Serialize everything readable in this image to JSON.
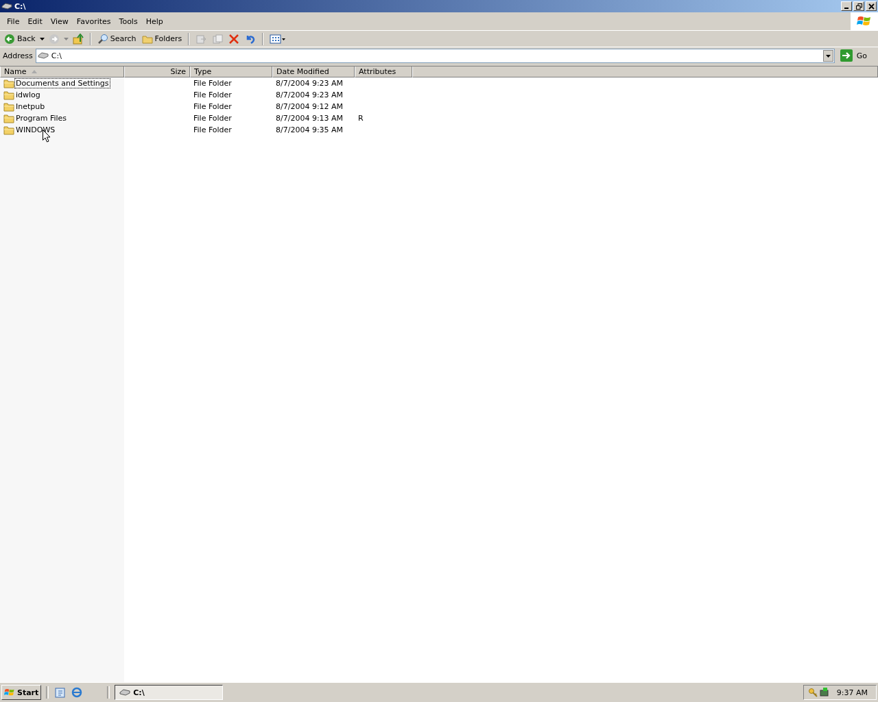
{
  "window": {
    "title": "C:\\"
  },
  "menu": [
    "File",
    "Edit",
    "View",
    "Favorites",
    "Tools",
    "Help"
  ],
  "toolbar": {
    "back": "Back",
    "search": "Search",
    "folders": "Folders"
  },
  "address": {
    "label": "Address",
    "value": "C:\\",
    "go": "Go"
  },
  "columns": [
    {
      "label": "Name",
      "sorted": true
    },
    {
      "label": "Size",
      "sorted": false
    },
    {
      "label": "Type",
      "sorted": false
    },
    {
      "label": "Date Modified",
      "sorted": false
    },
    {
      "label": "Attributes",
      "sorted": false
    }
  ],
  "rows": [
    {
      "name": "Documents and Settings",
      "type": "File Folder",
      "modified": "8/7/2004 9:23 AM",
      "selected": true
    },
    {
      "name": "idwlog",
      "type": "File Folder",
      "modified": "8/7/2004 9:23 AM",
      "selected": false
    },
    {
      "name": "Inetpub",
      "type": "File Folder",
      "modified": "8/7/2004 9:12 AM",
      "selected": false
    },
    {
      "name": "Program Files",
      "type": "File Folder",
      "modified": "8/7/2004 9:13 AM",
      "attributes": "R",
      "selected": false
    },
    {
      "name": "WINDOWS",
      "type": "File Folder",
      "modified": "8/7/2004 9:35 AM",
      "selected": false
    }
  ],
  "taskbar": {
    "start": "Start",
    "task": "C:\\",
    "clock": "9:37 AM"
  }
}
